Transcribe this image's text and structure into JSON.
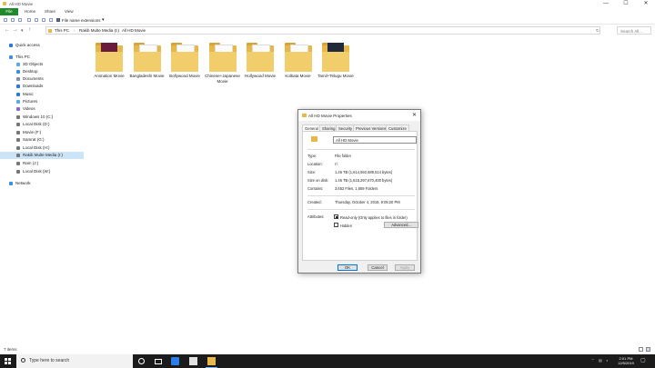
{
  "window": {
    "title": "All HD Movie",
    "controls": [
      "—",
      "☐",
      "✕"
    ]
  },
  "ribbon": {
    "tabs": [
      "File",
      "Home",
      "Share",
      "View"
    ]
  },
  "viewbar": {
    "file_ext_label": "File name extensions",
    "file_ext_checked": true
  },
  "address": {
    "crumbs": [
      "This PC",
      "Rakib Multe Media (I:)",
      "All HD Movie"
    ],
    "search_placeholder": "Search All..."
  },
  "nav_pane": {
    "items": [
      {
        "label": "Quick access",
        "icon": "star-icon",
        "color": "#2b79d8"
      },
      {
        "label": "This PC",
        "icon": "computer-icon",
        "color": "#3a8ee6"
      },
      {
        "label": "3D Objects",
        "icon": "cube-icon",
        "color": "#5aa7e8"
      },
      {
        "label": "Desktop",
        "icon": "desktop-icon",
        "color": "#3a8ee6"
      },
      {
        "label": "Documents",
        "icon": "document-icon",
        "color": "#7d8ea6"
      },
      {
        "label": "Downloads",
        "icon": "download-icon",
        "color": "#2b79d8"
      },
      {
        "label": "Music",
        "icon": "music-icon",
        "color": "#2b79d8"
      },
      {
        "label": "Pictures",
        "icon": "picture-icon",
        "color": "#5aa7e8"
      },
      {
        "label": "Videos",
        "icon": "video-icon",
        "color": "#7d6ec2"
      },
      {
        "label": "Windows 10 (C:)",
        "icon": "drive-icon",
        "color": "#777777"
      },
      {
        "label": "Local Disk (D:)",
        "icon": "drive-icon",
        "color": "#777777"
      },
      {
        "label": "Movie (F:)",
        "icon": "drive-icon",
        "color": "#777777"
      },
      {
        "label": "Samrat (G:)",
        "icon": "drive-icon",
        "color": "#777777"
      },
      {
        "label": "Local Disk (H:)",
        "icon": "drive-icon",
        "color": "#777777"
      },
      {
        "label": "Rakib Multe Media (I:)",
        "icon": "drive-icon",
        "color": "#777777",
        "selected": true
      },
      {
        "label": "Ram (J:)",
        "icon": "drive-icon",
        "color": "#777777"
      },
      {
        "label": "Local Disk (W:)",
        "icon": "drive-icon",
        "color": "#777777"
      },
      {
        "label": "Network",
        "icon": "network-icon",
        "color": "#3a8ee6"
      }
    ]
  },
  "folders": [
    {
      "name": "Animation Movie",
      "pic": "#6a1a3c"
    },
    {
      "name": "Bangladeshi Movie",
      "pic": ""
    },
    {
      "name": "Bollywood Movie",
      "pic": ""
    },
    {
      "name": "Chinese+Japanese Movie",
      "pic": ""
    },
    {
      "name": "Hollywood Movie",
      "pic": ""
    },
    {
      "name": "Kolkata Movie",
      "pic": ""
    },
    {
      "name": "Tamil+Telugu Movie",
      "pic": "#202a3a"
    }
  ],
  "status": {
    "count": "7 items"
  },
  "dialog": {
    "title": "All HD Movie Properties",
    "tabs": [
      "General",
      "Sharing",
      "Security",
      "Previous Versions",
      "Customize"
    ],
    "name_value": "All HD Movie",
    "rows": [
      {
        "k": "Type:",
        "v": "File folder"
      },
      {
        "k": "Location:",
        "v": "I:\\"
      },
      {
        "k": "Size:",
        "v": "1.46 TB (1,614,592,689,514 bytes)"
      },
      {
        "k": "Size on disk:",
        "v": "1.46 TB (1,615,297,670,400 bytes)"
      },
      {
        "k": "Contains:",
        "v": "3,652 Files, 1,659 Folders"
      },
      {
        "k": "Created:",
        "v": "Thursday, October 4, 2018, 9:05:20 PM"
      }
    ],
    "attributes_label": "Attributes:",
    "readonly_label": "Read-only (Only applies to files in folder)",
    "hidden_label": "Hidden",
    "advanced_label": "Advanced...",
    "ok_label": "OK",
    "cancel_label": "Cancel",
    "apply_label": "Apply"
  },
  "taskbar": {
    "search_text": "Type here to search",
    "time": "2:01 PM",
    "date": "12/5/2019",
    "accent": "#7db7f0"
  }
}
